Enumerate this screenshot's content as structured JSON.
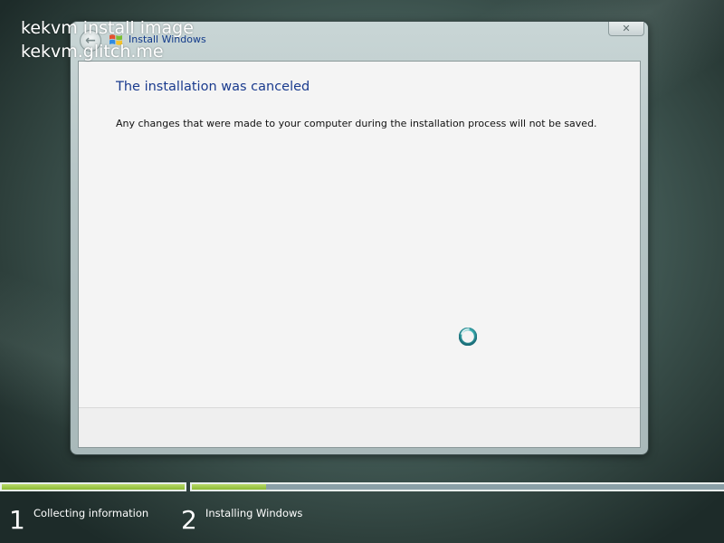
{
  "watermark": {
    "line1": "kekvm install image",
    "line2": "kekvm.glitch.me"
  },
  "window": {
    "title": "Install Windows",
    "back_icon": "back-arrow-icon",
    "close_label": "✕",
    "logo_icon": "windows-logo-icon"
  },
  "content": {
    "heading": "The installation was canceled",
    "message": "Any changes that were made to your computer during the installation process will not be saved.",
    "spinner_icon": "busy-spinner-icon"
  },
  "progress": {
    "steps": [
      {
        "number": "1",
        "label": "Collecting information",
        "progress": 1.0
      },
      {
        "number": "2",
        "label": "Installing Windows",
        "progress": 0.14
      }
    ],
    "colors": {
      "fill": "#8cbb34",
      "track": "#8aa0a7"
    }
  }
}
